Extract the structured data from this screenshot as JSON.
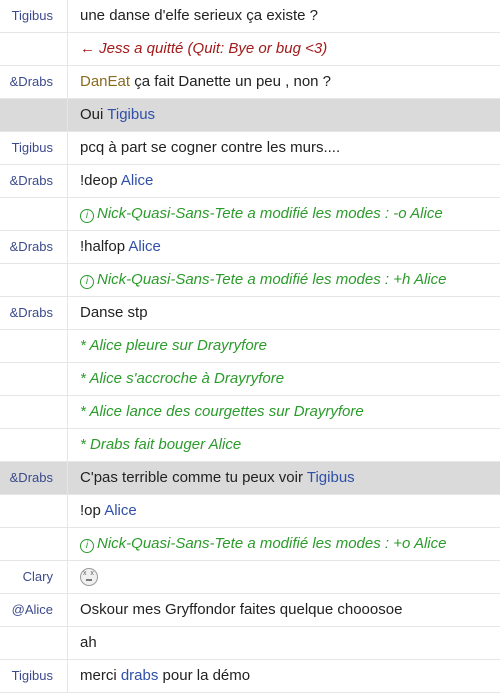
{
  "rows": [
    {
      "nick": "Tigibus",
      "kind": "text",
      "parts": [
        {
          "t": "une danse d'elfe serieux ça existe ?"
        }
      ]
    },
    {
      "nick": "",
      "kind": "quit",
      "parts": [
        {
          "t": "← Jess a quitté (Quit: Bye or bug <3)"
        }
      ]
    },
    {
      "nick": "&Drabs",
      "kind": "text",
      "parts": [
        {
          "t": "DanEat",
          "mention": "alt"
        },
        {
          "t": " ça fait Danette un peu , non ?"
        }
      ]
    },
    {
      "nick": "",
      "kind": "text",
      "highlight": true,
      "parts": [
        {
          "t": "Oui "
        },
        {
          "t": "Tigibus",
          "mention": "nick"
        }
      ]
    },
    {
      "nick": "Tigibus",
      "kind": "text",
      "parts": [
        {
          "t": "pcq à part se cogner contre les murs...."
        }
      ]
    },
    {
      "nick": "&Drabs",
      "kind": "text",
      "parts": [
        {
          "t": "!deop "
        },
        {
          "t": "Alice",
          "mention": "nick"
        }
      ]
    },
    {
      "nick": "",
      "kind": "mode",
      "icon": "info-icon",
      "parts": [
        {
          "t": "Nick-Quasi-Sans-Tete a modifié les modes : -o Alice"
        }
      ]
    },
    {
      "nick": "&Drabs",
      "kind": "text",
      "parts": [
        {
          "t": "!halfop "
        },
        {
          "t": "Alice",
          "mention": "nick"
        }
      ]
    },
    {
      "nick": "",
      "kind": "mode",
      "icon": "info-icon",
      "parts": [
        {
          "t": "Nick-Quasi-Sans-Tete a modifié les modes : +h Alice"
        }
      ]
    },
    {
      "nick": "&Drabs",
      "kind": "text",
      "parts": [
        {
          "t": "Danse stp"
        }
      ]
    },
    {
      "nick": "",
      "kind": "action",
      "parts": [
        {
          "t": "* Alice pleure sur Drayryfore"
        }
      ]
    },
    {
      "nick": "",
      "kind": "action",
      "parts": [
        {
          "t": "* Alice s'accroche à Drayryfore"
        }
      ]
    },
    {
      "nick": "",
      "kind": "action",
      "parts": [
        {
          "t": "* Alice lance des courgettes sur Drayryfore"
        }
      ]
    },
    {
      "nick": "",
      "kind": "action",
      "parts": [
        {
          "t": "* Drabs fait bouger Alice"
        }
      ]
    },
    {
      "nick": "&Drabs",
      "kind": "text",
      "highlight": true,
      "parts": [
        {
          "t": "C'pas terrible comme tu peux voir "
        },
        {
          "t": "Tigibus",
          "mention": "nick"
        }
      ]
    },
    {
      "nick": "",
      "kind": "text",
      "parts": [
        {
          "t": "!op "
        },
        {
          "t": "Alice",
          "mention": "nick"
        }
      ]
    },
    {
      "nick": "",
      "kind": "mode",
      "icon": "info-icon",
      "parts": [
        {
          "t": "Nick-Quasi-Sans-Tete a modifié les modes : +o Alice"
        }
      ]
    },
    {
      "nick": "Clary",
      "kind": "emoji",
      "icon": "dizzy-face-icon",
      "parts": []
    },
    {
      "nick": "@Alice",
      "kind": "text",
      "parts": [
        {
          "t": "Oskour mes Gryffondor faites quelque chooosoe"
        }
      ]
    },
    {
      "nick": "",
      "kind": "text",
      "parts": [
        {
          "t": "ah"
        }
      ]
    },
    {
      "nick": "Tigibus",
      "kind": "text",
      "parts": [
        {
          "t": "merci "
        },
        {
          "t": "drabs",
          "mention": "nick"
        },
        {
          "t": " pour la démo"
        }
      ]
    }
  ]
}
